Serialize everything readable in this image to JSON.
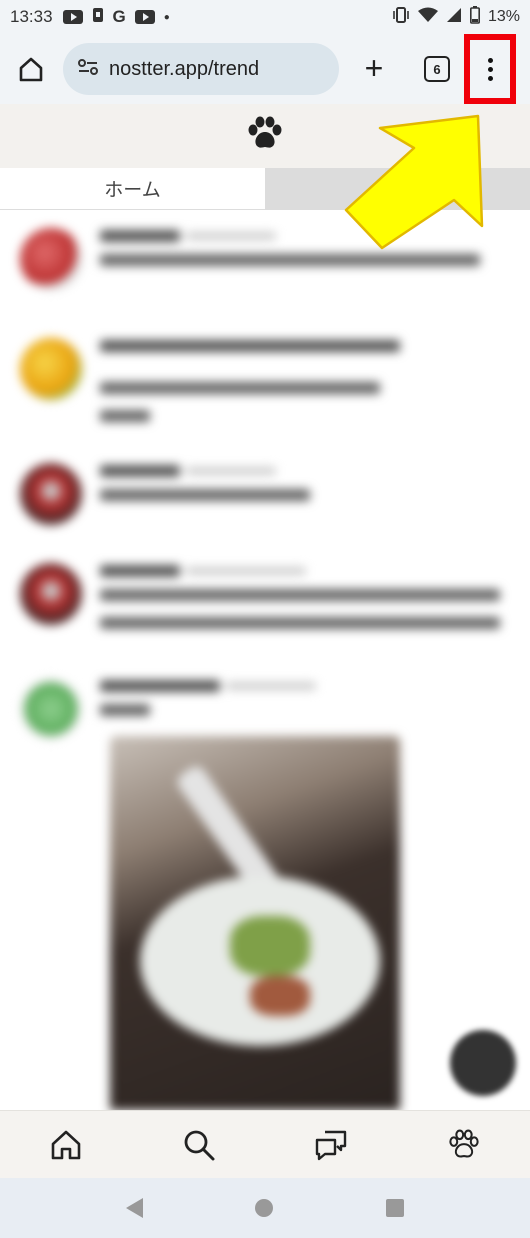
{
  "status_bar": {
    "time": "13:33",
    "battery": "13%",
    "left_icons": [
      "youtube-icon",
      "phone-lock-icon",
      "google-icon",
      "youtube-icon",
      "dot-icon"
    ],
    "right_icons": [
      "vibrate-icon",
      "wifi-icon",
      "signal-icon",
      "battery-icon"
    ]
  },
  "browser": {
    "url": "nostter.app/trend",
    "tab_count": "6",
    "icons": [
      "home-icon",
      "site-settings-icon",
      "plus-icon",
      "tab-switcher-icon",
      "more-menu-icon"
    ]
  },
  "app": {
    "logo_icon": "paw-icon",
    "tabs": [
      {
        "label": "ホーム",
        "active": true
      },
      {
        "label": "",
        "active": false
      }
    ]
  },
  "feed": {
    "note": "",
    "posts": [
      {
        "avatar_color": "#d9534f"
      },
      {
        "avatar_color": "#f0c419"
      },
      {
        "avatar_color": "#8b2a2a"
      },
      {
        "avatar_color": "#8b2a2a"
      },
      {
        "avatar_color": "#6cbf6c"
      }
    ]
  },
  "bottom_nav": {
    "items": [
      "home-icon",
      "search-icon",
      "chat-icon",
      "paw-icon"
    ]
  },
  "annotation": {
    "highlight_color": "#f0000a",
    "arrow_color": "#ffff00"
  }
}
